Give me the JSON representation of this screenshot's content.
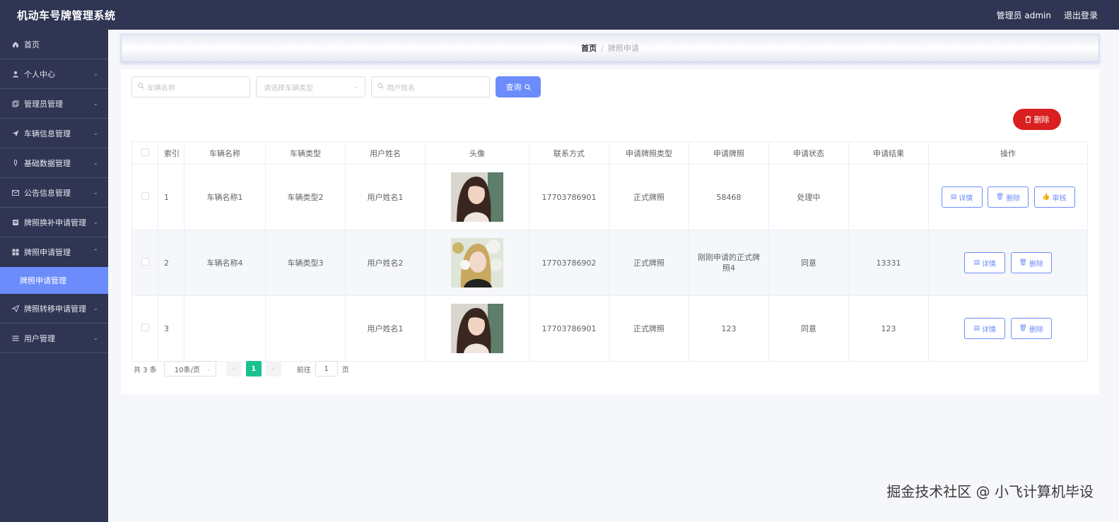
{
  "header": {
    "title": "机动车号牌管理系统",
    "admin_label": "管理员 admin",
    "logout": "退出登录"
  },
  "sidebar": {
    "items": [
      {
        "label": "首页",
        "icon": "home-icon"
      },
      {
        "label": "个人中心",
        "icon": "user-icon"
      },
      {
        "label": "管理员管理",
        "icon": "copy-icon"
      },
      {
        "label": "车辆信息管理",
        "icon": "send-icon"
      },
      {
        "label": "基础数据管理",
        "icon": "microphone-icon"
      },
      {
        "label": "公告信息管理",
        "icon": "mail-icon"
      },
      {
        "label": "牌照换补申请管理",
        "icon": "document-icon"
      },
      {
        "label": "牌照申请管理",
        "icon": "grid-icon"
      },
      {
        "label": "牌照转移申请管理",
        "icon": "send-icon"
      },
      {
        "label": "用户管理",
        "icon": "list-icon"
      }
    ],
    "active_sub": "牌照申请管理"
  },
  "breadcrumb": {
    "home": "首页",
    "current": "牌照申请"
  },
  "search": {
    "vehicle_name_placeholder": "车辆名称",
    "vehicle_type_placeholder": "请选择车辆类型",
    "user_name_placeholder": "用户姓名",
    "query_label": "查询"
  },
  "delete_label": "删除",
  "table": {
    "headers": [
      "索引",
      "车辆名称",
      "车辆类型",
      "用户姓名",
      "头像",
      "联系方式",
      "申请牌照类型",
      "申请牌照",
      "申请状态",
      "申请结果",
      "操作"
    ],
    "rows": [
      {
        "index": "1",
        "vehicle_name": "车辆名称1",
        "vehicle_type": "车辆类型2",
        "user_name": "用户姓名1",
        "phone": "17703786901",
        "plate_type": "正式牌照",
        "plate": "58468",
        "status": "处理中",
        "result": ""
      },
      {
        "index": "2",
        "vehicle_name": "车辆名称4",
        "vehicle_type": "车辆类型3",
        "user_name": "用户姓名2",
        "phone": "17703786902",
        "plate_type": "正式牌照",
        "plate": "刚刚申请的正式牌照4",
        "status": "同意",
        "result": "13331"
      },
      {
        "index": "3",
        "vehicle_name": "",
        "vehicle_type": "",
        "user_name": "用户姓名1",
        "phone": "17703786901",
        "plate_type": "正式牌照",
        "plate": "123",
        "status": "同意",
        "result": "123"
      }
    ],
    "op_detail": "详情",
    "op_delete": "删除",
    "op_review": "审核"
  },
  "pagination": {
    "total": "共 3 条",
    "page_size": "10条/页",
    "prev": "‹",
    "next": "›",
    "current_page": "1",
    "goto_label": "前往",
    "goto_value": "1",
    "page_suffix": "页"
  },
  "watermark": "掘金技术社区 @ 小飞计算机毕设",
  "colors": {
    "header_bg": "#2f3553",
    "accent": "#6c8cfc",
    "danger": "#d91f1f",
    "page_active": "#19c28e"
  }
}
